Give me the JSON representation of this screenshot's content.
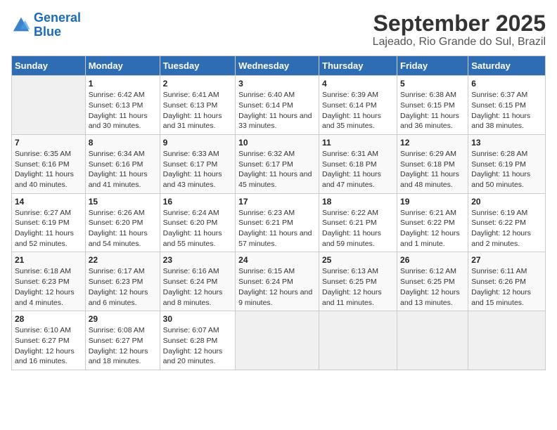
{
  "logo": {
    "line1": "General",
    "line2": "Blue"
  },
  "title": "September 2025",
  "subtitle": "Lajeado, Rio Grande do Sul, Brazil",
  "days_of_week": [
    "Sunday",
    "Monday",
    "Tuesday",
    "Wednesday",
    "Thursday",
    "Friday",
    "Saturday"
  ],
  "weeks": [
    [
      {
        "day": "",
        "sunrise": "",
        "sunset": "",
        "daylight": ""
      },
      {
        "day": "1",
        "sunrise": "Sunrise: 6:42 AM",
        "sunset": "Sunset: 6:13 PM",
        "daylight": "Daylight: 11 hours and 30 minutes."
      },
      {
        "day": "2",
        "sunrise": "Sunrise: 6:41 AM",
        "sunset": "Sunset: 6:13 PM",
        "daylight": "Daylight: 11 hours and 31 minutes."
      },
      {
        "day": "3",
        "sunrise": "Sunrise: 6:40 AM",
        "sunset": "Sunset: 6:14 PM",
        "daylight": "Daylight: 11 hours and 33 minutes."
      },
      {
        "day": "4",
        "sunrise": "Sunrise: 6:39 AM",
        "sunset": "Sunset: 6:14 PM",
        "daylight": "Daylight: 11 hours and 35 minutes."
      },
      {
        "day": "5",
        "sunrise": "Sunrise: 6:38 AM",
        "sunset": "Sunset: 6:15 PM",
        "daylight": "Daylight: 11 hours and 36 minutes."
      },
      {
        "day": "6",
        "sunrise": "Sunrise: 6:37 AM",
        "sunset": "Sunset: 6:15 PM",
        "daylight": "Daylight: 11 hours and 38 minutes."
      }
    ],
    [
      {
        "day": "7",
        "sunrise": "Sunrise: 6:35 AM",
        "sunset": "Sunset: 6:16 PM",
        "daylight": "Daylight: 11 hours and 40 minutes."
      },
      {
        "day": "8",
        "sunrise": "Sunrise: 6:34 AM",
        "sunset": "Sunset: 6:16 PM",
        "daylight": "Daylight: 11 hours and 41 minutes."
      },
      {
        "day": "9",
        "sunrise": "Sunrise: 6:33 AM",
        "sunset": "Sunset: 6:17 PM",
        "daylight": "Daylight: 11 hours and 43 minutes."
      },
      {
        "day": "10",
        "sunrise": "Sunrise: 6:32 AM",
        "sunset": "Sunset: 6:17 PM",
        "daylight": "Daylight: 11 hours and 45 minutes."
      },
      {
        "day": "11",
        "sunrise": "Sunrise: 6:31 AM",
        "sunset": "Sunset: 6:18 PM",
        "daylight": "Daylight: 11 hours and 47 minutes."
      },
      {
        "day": "12",
        "sunrise": "Sunrise: 6:29 AM",
        "sunset": "Sunset: 6:18 PM",
        "daylight": "Daylight: 11 hours and 48 minutes."
      },
      {
        "day": "13",
        "sunrise": "Sunrise: 6:28 AM",
        "sunset": "Sunset: 6:19 PM",
        "daylight": "Daylight: 11 hours and 50 minutes."
      }
    ],
    [
      {
        "day": "14",
        "sunrise": "Sunrise: 6:27 AM",
        "sunset": "Sunset: 6:19 PM",
        "daylight": "Daylight: 11 hours and 52 minutes."
      },
      {
        "day": "15",
        "sunrise": "Sunrise: 6:26 AM",
        "sunset": "Sunset: 6:20 PM",
        "daylight": "Daylight: 11 hours and 54 minutes."
      },
      {
        "day": "16",
        "sunrise": "Sunrise: 6:24 AM",
        "sunset": "Sunset: 6:20 PM",
        "daylight": "Daylight: 11 hours and 55 minutes."
      },
      {
        "day": "17",
        "sunrise": "Sunrise: 6:23 AM",
        "sunset": "Sunset: 6:21 PM",
        "daylight": "Daylight: 11 hours and 57 minutes."
      },
      {
        "day": "18",
        "sunrise": "Sunrise: 6:22 AM",
        "sunset": "Sunset: 6:21 PM",
        "daylight": "Daylight: 11 hours and 59 minutes."
      },
      {
        "day": "19",
        "sunrise": "Sunrise: 6:21 AM",
        "sunset": "Sunset: 6:22 PM",
        "daylight": "Daylight: 12 hours and 1 minute."
      },
      {
        "day": "20",
        "sunrise": "Sunrise: 6:19 AM",
        "sunset": "Sunset: 6:22 PM",
        "daylight": "Daylight: 12 hours and 2 minutes."
      }
    ],
    [
      {
        "day": "21",
        "sunrise": "Sunrise: 6:18 AM",
        "sunset": "Sunset: 6:23 PM",
        "daylight": "Daylight: 12 hours and 4 minutes."
      },
      {
        "day": "22",
        "sunrise": "Sunrise: 6:17 AM",
        "sunset": "Sunset: 6:23 PM",
        "daylight": "Daylight: 12 hours and 6 minutes."
      },
      {
        "day": "23",
        "sunrise": "Sunrise: 6:16 AM",
        "sunset": "Sunset: 6:24 PM",
        "daylight": "Daylight: 12 hours and 8 minutes."
      },
      {
        "day": "24",
        "sunrise": "Sunrise: 6:15 AM",
        "sunset": "Sunset: 6:24 PM",
        "daylight": "Daylight: 12 hours and 9 minutes."
      },
      {
        "day": "25",
        "sunrise": "Sunrise: 6:13 AM",
        "sunset": "Sunset: 6:25 PM",
        "daylight": "Daylight: 12 hours and 11 minutes."
      },
      {
        "day": "26",
        "sunrise": "Sunrise: 6:12 AM",
        "sunset": "Sunset: 6:25 PM",
        "daylight": "Daylight: 12 hours and 13 minutes."
      },
      {
        "day": "27",
        "sunrise": "Sunrise: 6:11 AM",
        "sunset": "Sunset: 6:26 PM",
        "daylight": "Daylight: 12 hours and 15 minutes."
      }
    ],
    [
      {
        "day": "28",
        "sunrise": "Sunrise: 6:10 AM",
        "sunset": "Sunset: 6:27 PM",
        "daylight": "Daylight: 12 hours and 16 minutes."
      },
      {
        "day": "29",
        "sunrise": "Sunrise: 6:08 AM",
        "sunset": "Sunset: 6:27 PM",
        "daylight": "Daylight: 12 hours and 18 minutes."
      },
      {
        "day": "30",
        "sunrise": "Sunrise: 6:07 AM",
        "sunset": "Sunset: 6:28 PM",
        "daylight": "Daylight: 12 hours and 20 minutes."
      },
      {
        "day": "",
        "sunrise": "",
        "sunset": "",
        "daylight": ""
      },
      {
        "day": "",
        "sunrise": "",
        "sunset": "",
        "daylight": ""
      },
      {
        "day": "",
        "sunrise": "",
        "sunset": "",
        "daylight": ""
      },
      {
        "day": "",
        "sunrise": "",
        "sunset": "",
        "daylight": ""
      }
    ]
  ]
}
